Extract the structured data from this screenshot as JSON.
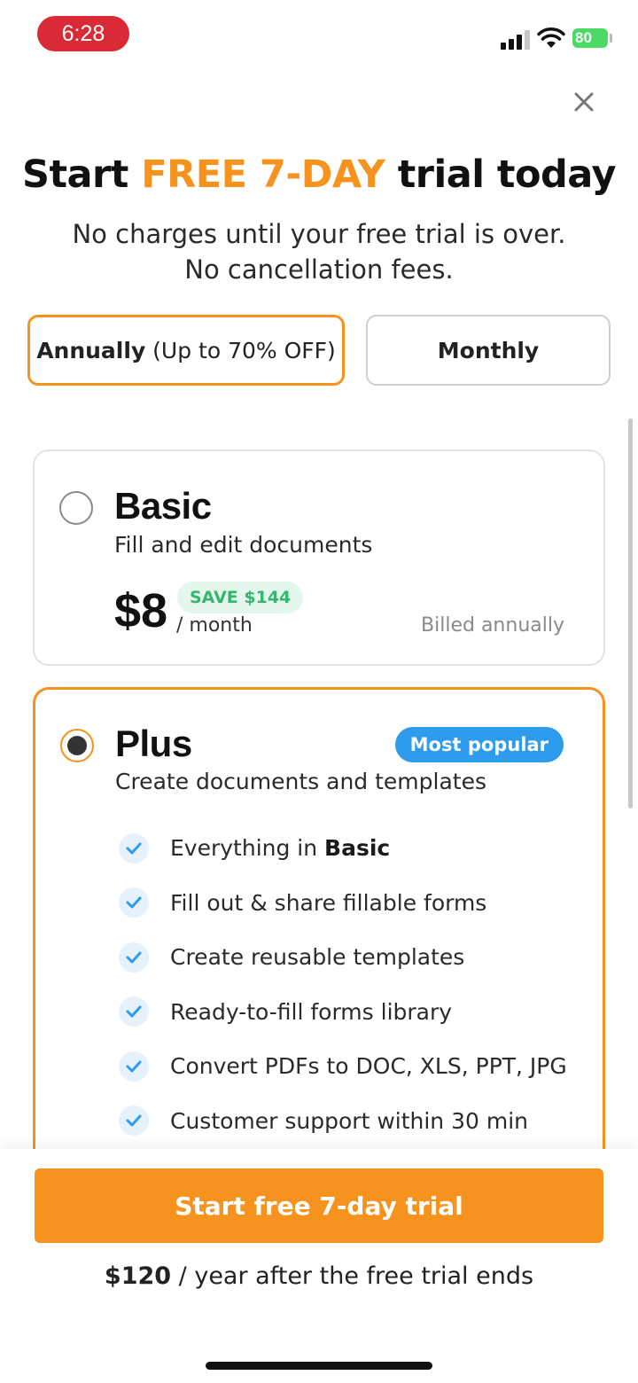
{
  "status_bar": {
    "time": "6:28",
    "battery": "80"
  },
  "header": {
    "title_start": "Start ",
    "title_accent": "FREE 7-DAY",
    "title_end": " trial today",
    "subtitle_line1": "No charges until your free trial is over.",
    "subtitle_line2": "No cancellation fees."
  },
  "billing_toggle": {
    "annual_bold": "Annually",
    "annual_rest": " (Up to 70% OFF)",
    "monthly": "Monthly",
    "selected": "annual"
  },
  "plans": {
    "basic": {
      "name": "Basic",
      "description": "Fill and edit documents",
      "price": "$8",
      "per": "/ month",
      "save_badge": "SAVE $144",
      "billed": "Billed annually",
      "selected": false
    },
    "plus": {
      "name": "Plus",
      "description": "Create documents and templates",
      "badge": "Most popular",
      "selected": true,
      "features": [
        {
          "text": "Everything in ",
          "bold": "Basic"
        },
        {
          "text": "Fill out & share fillable forms",
          "bold": ""
        },
        {
          "text": "Create reusable templates",
          "bold": ""
        },
        {
          "text": "Ready-to-fill forms library",
          "bold": ""
        },
        {
          "text": "Convert PDFs to DOC, XLS, PPT, JPG",
          "bold": ""
        },
        {
          "text": "Customer support within 30 min",
          "bold": ""
        }
      ]
    }
  },
  "footer": {
    "cta": "Start free 7-day trial",
    "price_bold": "$120",
    "price_rest": " / year after the free trial ends"
  },
  "colors": {
    "accent": "#f5931e",
    "badge_blue": "#2d9cec",
    "save_green": "#35b56f",
    "time_pill": "#d92a35"
  },
  "icons": [
    "signal-icon",
    "wifi-icon",
    "battery-icon",
    "close-icon",
    "radio-icon",
    "check-icon"
  ]
}
